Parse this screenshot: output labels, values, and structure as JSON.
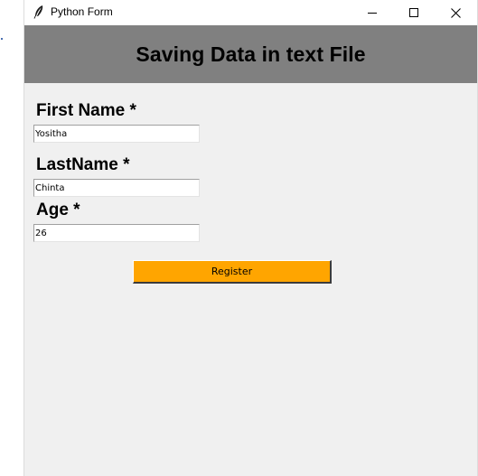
{
  "window": {
    "title": "Python Form",
    "app_icon": "feather-icon",
    "controls": {
      "minimize_icon": "minimize-icon",
      "maximize_icon": "maximize-icon",
      "close_icon": "close-icon"
    }
  },
  "header": {
    "title": "Saving Data in text File",
    "background": "#808080"
  },
  "form": {
    "first_name": {
      "label": "First Name *",
      "value": "Yositha"
    },
    "last_name": {
      "label": "LastName *",
      "value": "Chinta"
    },
    "age": {
      "label": "Age *",
      "value": "26"
    },
    "register_label": "Register",
    "register_color": "#ffa500"
  }
}
